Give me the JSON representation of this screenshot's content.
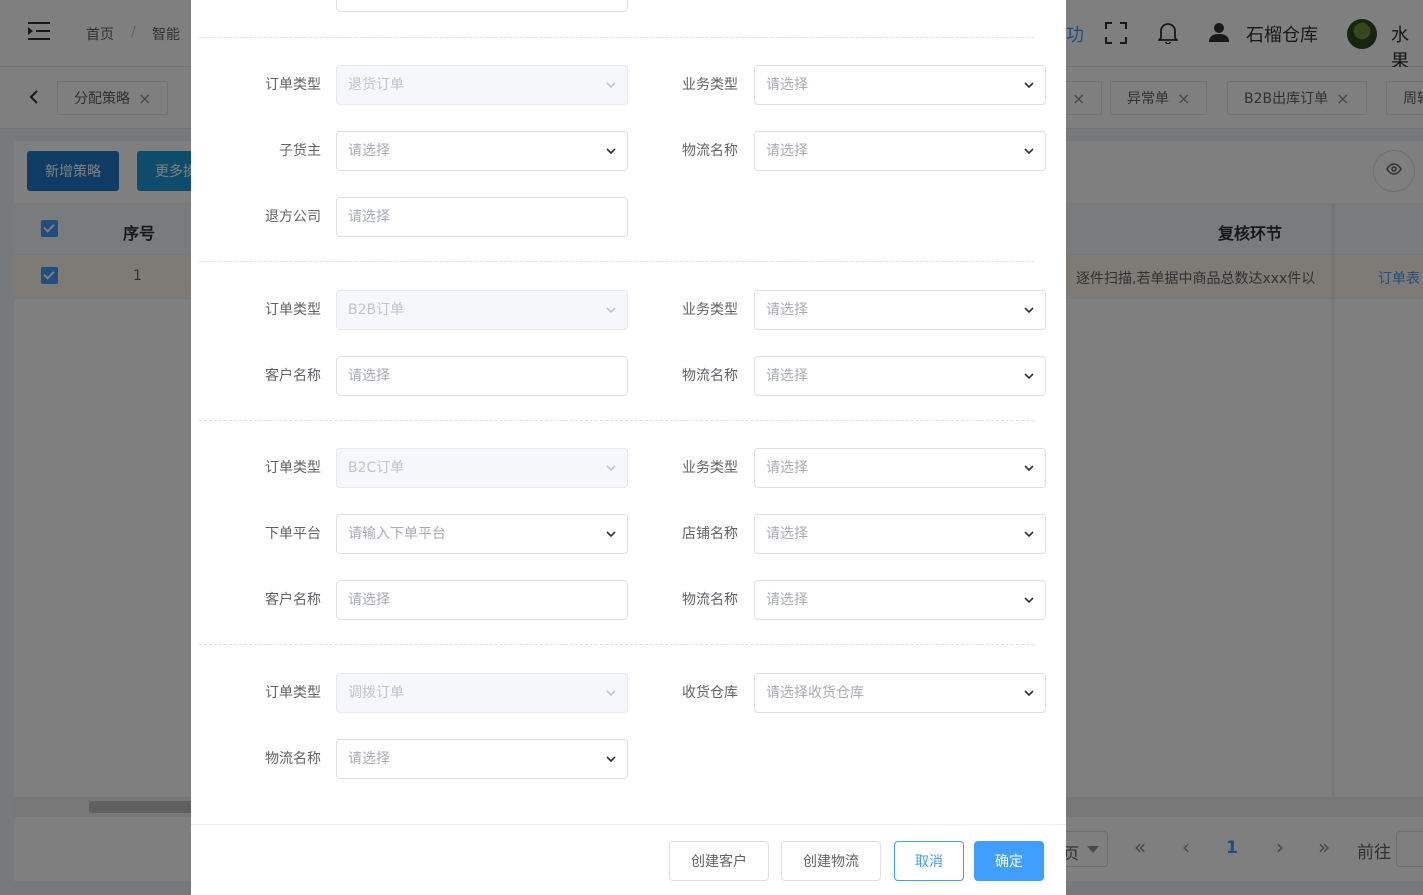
{
  "header": {
    "breadcrumb": [
      "首页",
      "智能"
    ],
    "breadcrumb_sep": "/",
    "partial_menu_text": "功",
    "warehouse_name": "石榴仓库",
    "user_name": "水果"
  },
  "tabs": [
    {
      "label": "分配策略",
      "close": "×"
    },
    {
      "label": "",
      "close": "×"
    },
    {
      "label": "异常单",
      "close": "×"
    },
    {
      "label": "B2B出库订单",
      "close": "×"
    },
    {
      "label": "周转",
      "close": ""
    }
  ],
  "toolbar": {
    "add_strategy": "新增策略",
    "more": "更多操"
  },
  "table": {
    "headers": {
      "index": "序号",
      "review_step": "复核环节"
    },
    "rows": [
      {
        "index": "1",
        "review_step": "逐件扫描,若单据中商品总数达xxx件以",
        "extra": "订单表"
      }
    ]
  },
  "pager": {
    "page_size_suffix": "页",
    "current_page": "1",
    "goto": "前往"
  },
  "dialog": {
    "sections": [
      {
        "fields": [
          {
            "label": "订单类型",
            "placeholder": "退货订单",
            "disabled": true,
            "select": true
          },
          {
            "label": "业务类型",
            "placeholder": "请选择",
            "disabled": false,
            "select": true
          },
          {
            "label": "子货主",
            "placeholder": "请选择",
            "disabled": false,
            "select": true
          },
          {
            "label": "物流名称",
            "placeholder": "请选择",
            "disabled": false,
            "select": true
          },
          {
            "label": "退方公司",
            "placeholder": "请选择",
            "disabled": false,
            "select": false
          }
        ]
      },
      {
        "fields": [
          {
            "label": "订单类型",
            "placeholder": "B2B订单",
            "disabled": true,
            "select": true
          },
          {
            "label": "业务类型",
            "placeholder": "请选择",
            "disabled": false,
            "select": true
          },
          {
            "label": "客户名称",
            "placeholder": "请选择",
            "disabled": false,
            "select": false
          },
          {
            "label": "物流名称",
            "placeholder": "请选择",
            "disabled": false,
            "select": true
          }
        ]
      },
      {
        "fields": [
          {
            "label": "订单类型",
            "placeholder": "B2C订单",
            "disabled": true,
            "select": true
          },
          {
            "label": "业务类型",
            "placeholder": "请选择",
            "disabled": false,
            "select": true
          },
          {
            "label": "下单平台",
            "placeholder": "请输入下单平台",
            "disabled": false,
            "select": true
          },
          {
            "label": "店铺名称",
            "placeholder": "请选择",
            "disabled": false,
            "select": true
          },
          {
            "label": "客户名称",
            "placeholder": "请选择",
            "disabled": false,
            "select": false
          },
          {
            "label": "物流名称",
            "placeholder": "请选择",
            "disabled": false,
            "select": true
          }
        ]
      },
      {
        "fields": [
          {
            "label": "订单类型",
            "placeholder": "调拨订单",
            "disabled": true,
            "select": true
          },
          {
            "label": "收货仓库",
            "placeholder": "请选择收货仓库",
            "disabled": false,
            "select": true
          },
          {
            "label": "物流名称",
            "placeholder": "请选择",
            "disabled": false,
            "select": true
          }
        ]
      }
    ],
    "footer": {
      "create_customer": "创建客户",
      "create_logistics": "创建物流",
      "cancel": "取消",
      "confirm": "确定"
    }
  },
  "colors": {
    "primary": "#409eff",
    "bg_button_primary": "#1f78c8",
    "row_highlight": "#fdf6ec"
  }
}
